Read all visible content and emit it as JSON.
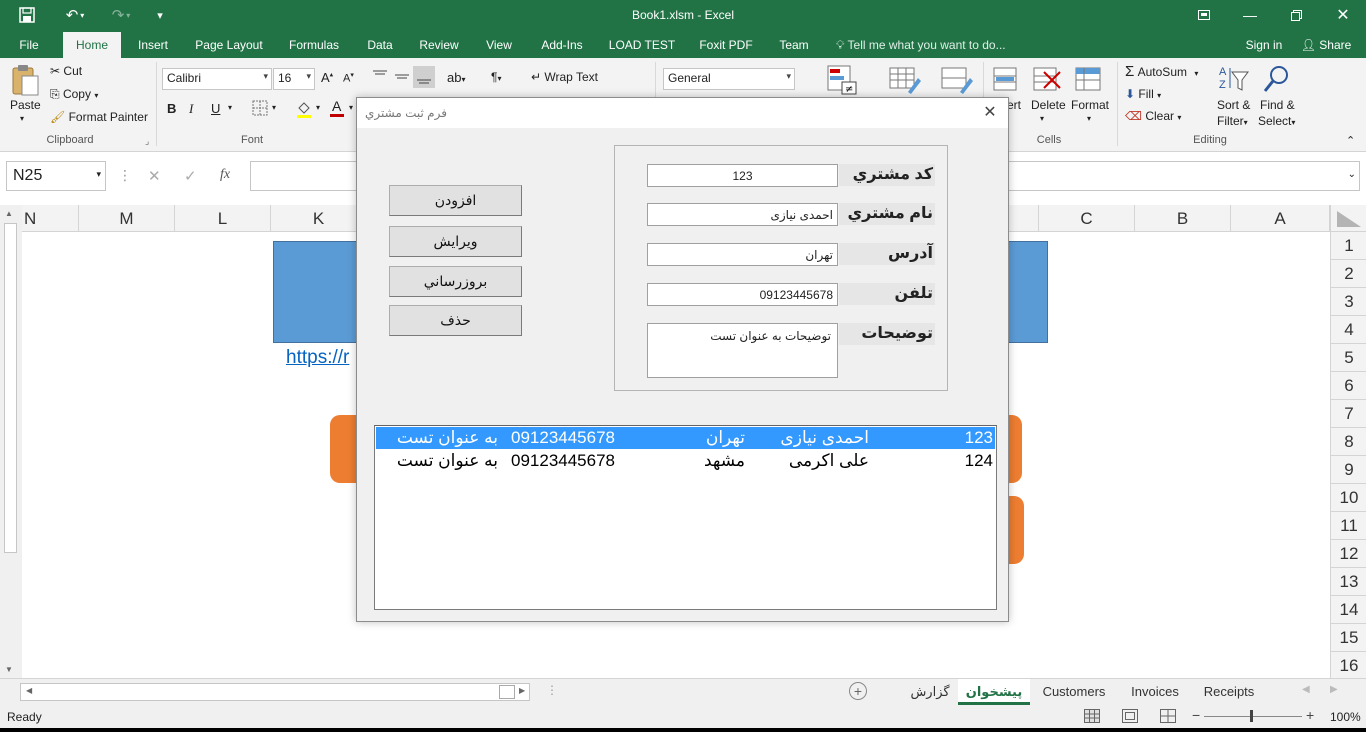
{
  "window": {
    "title": "Book1.xlsm - Excel"
  },
  "menu": {
    "tabs": [
      "File",
      "Home",
      "Insert",
      "Page Layout",
      "Formulas",
      "Data",
      "Review",
      "View",
      "Add-Ins",
      "LOAD TEST",
      "Foxit PDF",
      "Team"
    ],
    "tell_me": "Tell me what you want to do...",
    "sign_in": "Sign in",
    "share": "Share"
  },
  "ribbon": {
    "clipboard": {
      "paste": "Paste",
      "cut": "Cut",
      "copy": "Copy",
      "format_painter": "Format Painter",
      "label": "Clipboard"
    },
    "font": {
      "name": "Calibri",
      "size": "16",
      "bold": "B",
      "italic": "I",
      "underline": "U",
      "label": "Font"
    },
    "alignment": {
      "wrap_text": "Wrap Text"
    },
    "number": {
      "format": "General"
    },
    "cells": {
      "insert_partial": "ert",
      "delete": "Delete",
      "format": "Format",
      "label": "Cells"
    },
    "editing": {
      "autosum": "AutoSum",
      "fill": "Fill",
      "clear": "Clear",
      "sort_filter_1": "Sort &",
      "sort_filter_2": "Filter",
      "find_select_1": "Find &",
      "find_select_2": "Select",
      "label": "Editing"
    }
  },
  "formula_bar": {
    "name_box": "N25",
    "fx": "fx"
  },
  "sheet": {
    "columns_left": [
      "N",
      "M",
      "L",
      "K"
    ],
    "columns_right": [
      "C",
      "B",
      "A"
    ],
    "rows": [
      "1",
      "2",
      "3",
      "4",
      "5",
      "6",
      "7",
      "8",
      "9",
      "10",
      "11",
      "12",
      "13",
      "14",
      "15",
      "16"
    ],
    "hyperlink_partial": "https://r"
  },
  "sheet_tabs": {
    "tabs": [
      "گزارش",
      "پیشخوان",
      "Customers",
      "Invoices",
      "Receipts"
    ],
    "active": "پیشخوان"
  },
  "status": {
    "ready": "Ready",
    "zoom": "100%"
  },
  "dialog": {
    "title": "فرم ثبت مشتري",
    "fields": {
      "code_label": "کد مشتري",
      "code_value": "123",
      "name_label": "نام مشتري",
      "name_value": "احمدی نیازی",
      "address_label": "آدرس",
      "address_value": "تهران",
      "phone_label": "تلفن",
      "phone_value": "09123445678",
      "notes_label": "توضیحات",
      "notes_value": "توضیحات به عنوان تست"
    },
    "buttons": {
      "add": "افزودن",
      "edit": "ويرايش",
      "update": "بروزرساني",
      "delete": "حذف"
    },
    "list": [
      {
        "code": "123",
        "name": "احمدی نیازی",
        "city": "تهران",
        "phone": "09123445678",
        "note": "به عنوان تست"
      },
      {
        "code": "124",
        "name": "علی اکرمی",
        "city": "مشهد",
        "phone": "09123445678",
        "note": "به عنوان تست"
      }
    ]
  },
  "colors": {
    "excel_green": "#217346",
    "shape_blue": "#5b9bd5",
    "shape_orange": "#ed7d31",
    "selection_blue": "#3399ff"
  }
}
